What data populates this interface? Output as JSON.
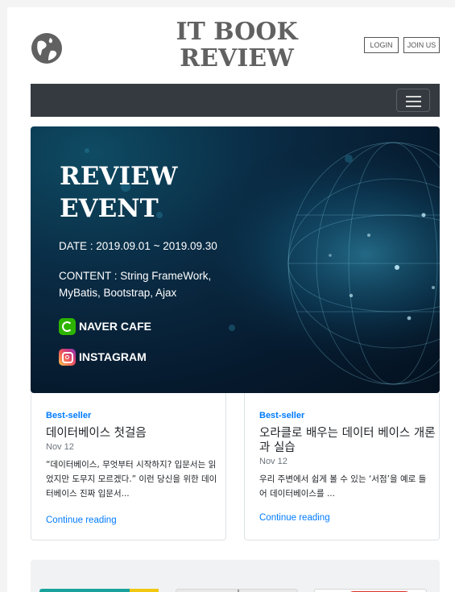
{
  "header": {
    "title_line1": "IT BOOK",
    "title_line2": "REVIEW",
    "login_label": "LOGIN",
    "join_label": "JOIN US"
  },
  "navbar": {
    "toggler_icon": "hamburger-icon"
  },
  "banner": {
    "title_line1": "REVIEW",
    "title_line2": "EVENT",
    "date": "DATE : 2019.09.01 ~ 2019.09.30",
    "content_line1": "CONTENT : String FrameWork,",
    "content_line2": "MyBatis, Bootstrap, Ajax",
    "naver_label": "NAVER CAFE",
    "instagram_label": "INSTAGRAM"
  },
  "cards": [
    {
      "category": "Best-seller",
      "title": "데이터베이스 첫걸음",
      "date": "Nov 12",
      "text": "“데이터베이스, 무엇부터 시작하지? 입문서는 읽었지만 도무지 모르겠다.” 이런 당신을 위한 데이터베이스 진짜 입문서...",
      "link": "Continue reading"
    },
    {
      "category": "Best-seller",
      "title": "오라클로 배우는 데이터 베이스 개론과 실습",
      "date": "Nov 12",
      "text": "우리 주변에서 쉽게 볼 수 있는 ‘서점’을 예로 들어 데이터베이스를 ...",
      "link": "Continue reading"
    }
  ],
  "colors": {
    "accent": "#007bff",
    "navbar": "#343a40",
    "title_gray": "#616161",
    "naver_green": "#2db400"
  }
}
